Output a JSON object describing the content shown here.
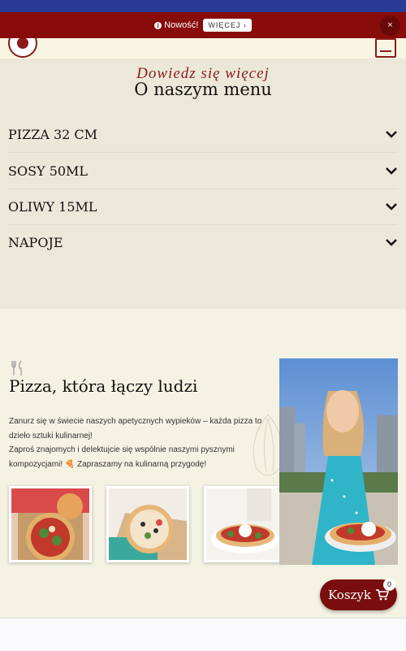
{
  "notice": {
    "label": "Nowość!",
    "more_label": "WIĘCEJ ›",
    "close_label": "×"
  },
  "menu": {
    "subtitle": "Dowiedz się więcej",
    "title": "O naszym menu",
    "items": [
      {
        "label": "PIZZA 32 CM"
      },
      {
        "label": "SOSY 50ML"
      },
      {
        "label": "OLIWY 15ML"
      },
      {
        "label": "NAPOJE"
      }
    ]
  },
  "story": {
    "title": "Pizza, która łączy ludzi",
    "paragraph1": "Zanurz się w świecie naszych apetycznych wypieków – każda pizza to dzieło sztuki kulinarnej!",
    "paragraph2": "Zaproś znajomych i delektujcie się wspólnie naszymi pysznymi kompozycjami! 🍕 Zapraszamy na kulinarną przygodę!"
  },
  "cart": {
    "label": "Koszyk",
    "count": "0"
  },
  "colors": {
    "brand": "#880c0c",
    "top_bar": "#2a3a95",
    "background": "#f4f2e3",
    "menu_bg": "#ebe8d9"
  }
}
